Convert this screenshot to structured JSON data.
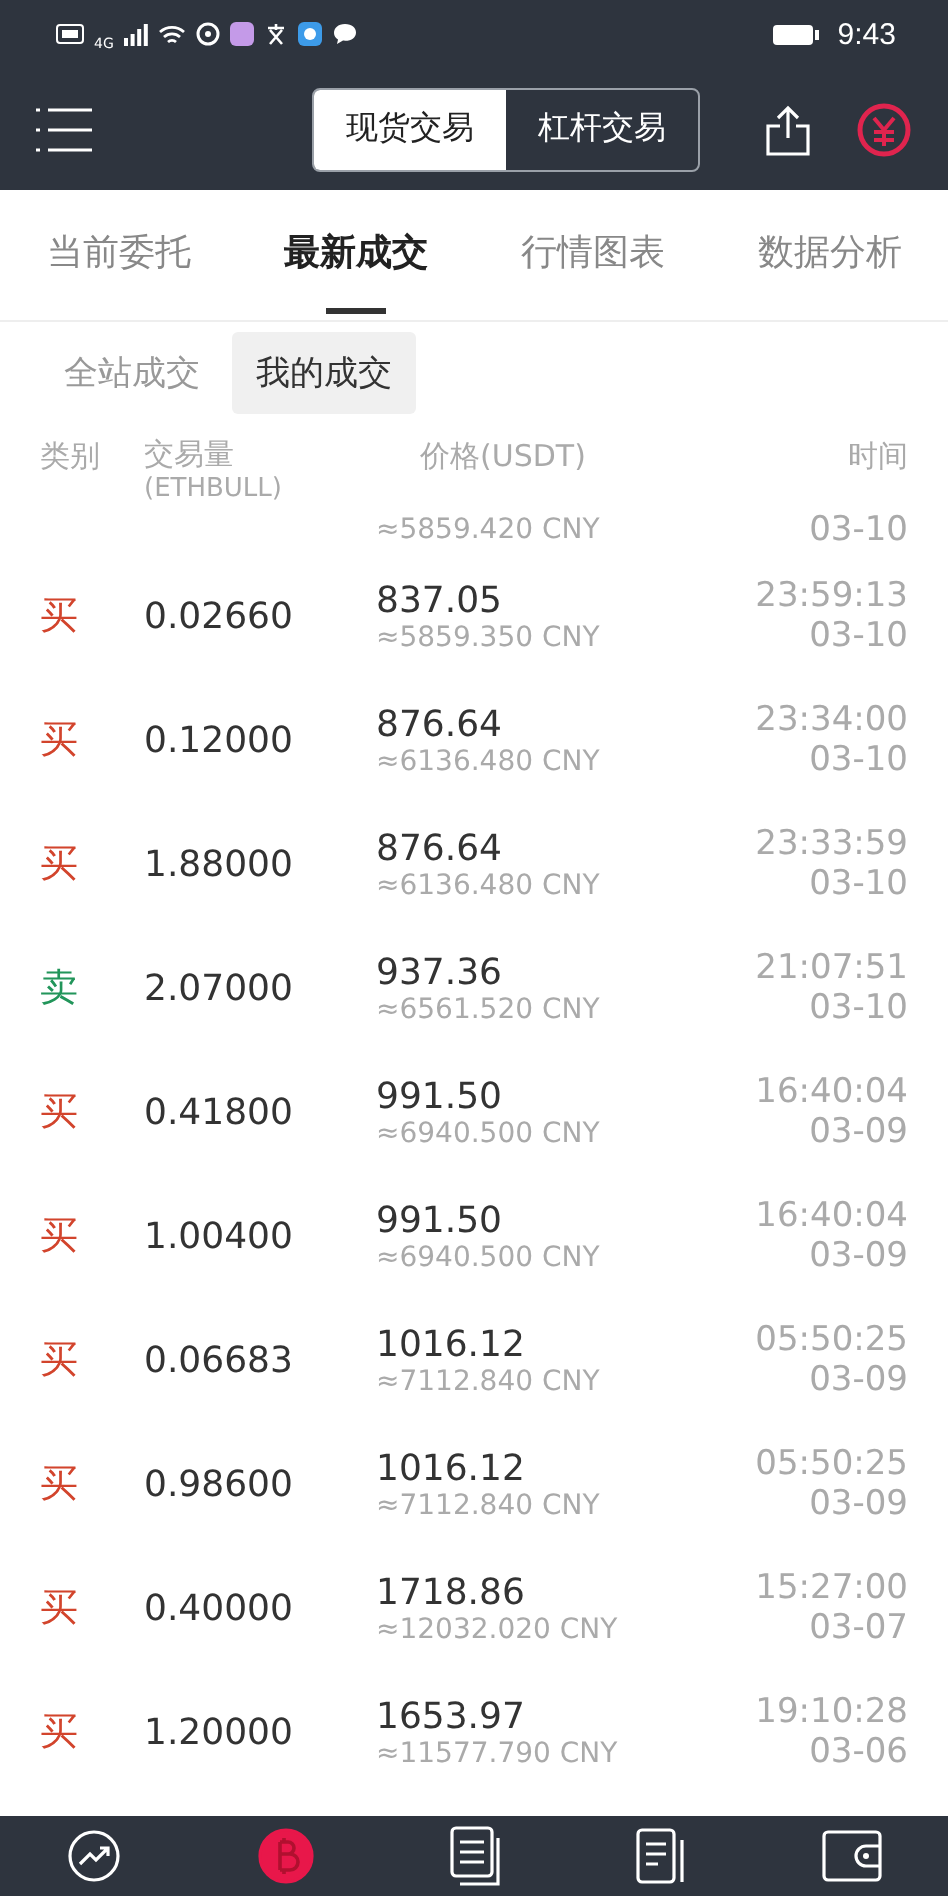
{
  "status_bar": {
    "network": "4G",
    "time": "9:43"
  },
  "header": {
    "segments": [
      {
        "label": "现货交易",
        "selected": true
      },
      {
        "label": "杠杆交易",
        "selected": false
      }
    ]
  },
  "tabs": [
    {
      "label": "当前委托",
      "selected": false
    },
    {
      "label": "最新成交",
      "selected": true
    },
    {
      "label": "行情图表",
      "selected": false
    },
    {
      "label": "数据分析",
      "selected": false
    }
  ],
  "subtabs": [
    {
      "label": "全站成交",
      "selected": false
    },
    {
      "label": "我的成交",
      "selected": true
    }
  ],
  "table": {
    "columns": [
      "类别",
      "交易量",
      "价格(USDT)",
      "时间"
    ],
    "amount_unit": "(ETHBULL)",
    "partial_row": {
      "cny": "≈5859.420 CNY",
      "date": "03-10"
    },
    "rows": [
      {
        "kind": "buy",
        "side": "买",
        "amount": "0.02660",
        "price": "837.05",
        "cny": "≈5859.350 CNY",
        "time": "23:59:13",
        "date": "03-10"
      },
      {
        "kind": "buy",
        "side": "买",
        "amount": "0.12000",
        "price": "876.64",
        "cny": "≈6136.480 CNY",
        "time": "23:34:00",
        "date": "03-10"
      },
      {
        "kind": "buy",
        "side": "买",
        "amount": "1.88000",
        "price": "876.64",
        "cny": "≈6136.480 CNY",
        "time": "23:33:59",
        "date": "03-10"
      },
      {
        "kind": "sell",
        "side": "卖",
        "amount": "2.07000",
        "price": "937.36",
        "cny": "≈6561.520 CNY",
        "time": "21:07:51",
        "date": "03-10"
      },
      {
        "kind": "buy",
        "side": "买",
        "amount": "0.41800",
        "price": "991.50",
        "cny": "≈6940.500 CNY",
        "time": "16:40:04",
        "date": "03-09"
      },
      {
        "kind": "buy",
        "side": "买",
        "amount": "1.00400",
        "price": "991.50",
        "cny": "≈6940.500 CNY",
        "time": "16:40:04",
        "date": "03-09"
      },
      {
        "kind": "buy",
        "side": "买",
        "amount": "0.06683",
        "price": "1016.12",
        "cny": "≈7112.840 CNY",
        "time": "05:50:25",
        "date": "03-09"
      },
      {
        "kind": "buy",
        "side": "买",
        "amount": "0.98600",
        "price": "1016.12",
        "cny": "≈7112.840 CNY",
        "time": "05:50:25",
        "date": "03-09"
      },
      {
        "kind": "buy",
        "side": "买",
        "amount": "0.40000",
        "price": "1718.86",
        "cny": "≈12032.020 CNY",
        "time": "15:27:00",
        "date": "03-07"
      },
      {
        "kind": "buy",
        "side": "买",
        "amount": "1.20000",
        "price": "1653.97",
        "cny": "≈11577.790 CNY",
        "time": "19:10:28",
        "date": "03-06"
      }
    ]
  },
  "bottom_nav": [
    {
      "kind": "chart",
      "selected": false
    },
    {
      "kind": "coin",
      "selected": true
    },
    {
      "kind": "docs",
      "selected": false
    },
    {
      "kind": "news",
      "selected": false
    },
    {
      "kind": "wallet",
      "selected": false
    }
  ]
}
